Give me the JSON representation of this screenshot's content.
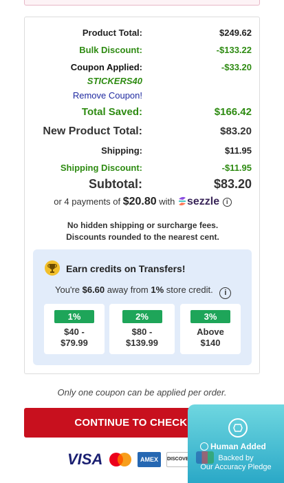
{
  "summary": {
    "product_total_label": "Product Total:",
    "product_total_value": "$249.62",
    "bulk_discount_label": "Bulk Discount:",
    "bulk_discount_value": "-$133.22",
    "coupon_applied_label": "Coupon Applied:",
    "coupon_code": "STICKERS40",
    "coupon_value": "-$33.20",
    "remove_coupon": "Remove Coupon!",
    "total_saved_label": "Total Saved:",
    "total_saved_value": "$166.42",
    "new_product_total_label": "New Product Total:",
    "new_product_total_value": "$83.20",
    "shipping_label": "Shipping:",
    "shipping_value": "$11.95",
    "shipping_discount_label": "Shipping Discount:",
    "shipping_discount_value": "-$11.95",
    "subtotal_label": "Subtotal:",
    "subtotal_value": "$83.20"
  },
  "installments": {
    "prefix": "or 4 payments of",
    "amount": "$20.80",
    "with": "with",
    "provider": "sezzle",
    "icon": "info-icon"
  },
  "notices": {
    "line1": "No hidden shipping or surcharge fees.",
    "line2": "Discounts rounded to the nearest cent."
  },
  "credits": {
    "icon": "trophy-icon",
    "title": "Earn credits on Transfers!",
    "away_prefix": "You're",
    "away_amount": "$6.60",
    "away_middle": "away from",
    "away_pct": "1%",
    "away_suffix": "store credit.",
    "tiers": [
      {
        "pct": "1%",
        "range_line1": "$40 -",
        "range_line2": "$79.99"
      },
      {
        "pct": "2%",
        "range_line1": "$80 -",
        "range_line2": "$139.99"
      },
      {
        "pct": "3%",
        "range_line1": "Above",
        "range_line2": "$140"
      }
    ]
  },
  "coupon_note": "Only one coupon can be applied per order.",
  "checkout_button": "CONTINUE TO CHECKOUT",
  "payment_methods": {
    "visa": "VISA",
    "amex": "AMEX",
    "discover": "DISCOVER",
    "mastercard": "mastercard-icon",
    "jcb": "jcb-icon"
  },
  "badge": {
    "title": "Human Added",
    "line1": "Backed by",
    "line2": "Our Accuracy Pledge"
  },
  "colors": {
    "green": "#2e8b12",
    "checkout_red": "#c8101e",
    "credits_bg": "#e2ecfa",
    "tier_green": "#1ea559",
    "badge_teal": "#2aa8c7",
    "remove_link": "#1f2aa0"
  }
}
